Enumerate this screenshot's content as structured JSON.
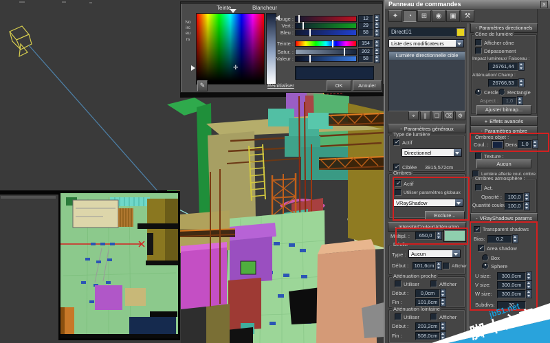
{
  "colors": {
    "annotation": "#d42020",
    "object_swatch": "#e8d31f",
    "multiplier_swatch": "#8fcfae",
    "shadow_color_swatch": "#15233f",
    "picker_preview": "#17263f",
    "watermark_blue": "#29a3dc"
  },
  "picker": {
    "hue_label": "Teinte",
    "whiteness_label": "Blancheur",
    "blackness_label": "Noirceurs",
    "eyedropper_glyph": "✎",
    "sliders": [
      {
        "label": "Rouge :",
        "value": "12"
      },
      {
        "label": "Vert :",
        "value": "29"
      },
      {
        "label": "Bleu :",
        "value": "58"
      },
      {
        "label": "Teinte :",
        "value": "154"
      },
      {
        "label": "Satur. :",
        "value": "202"
      },
      {
        "label": "Valeur :",
        "value": "58"
      }
    ],
    "reset_label": "Réinitialiser",
    "ok_label": "OK",
    "cancel_label": "Annuler"
  },
  "panel": {
    "title": "Panneau de commandes",
    "close_glyph": "×",
    "tabs": [
      {
        "name": "create",
        "glyph": "✦"
      },
      {
        "name": "modify",
        "glyph": "◔"
      },
      {
        "name": "hierarchy",
        "glyph": "⊞"
      },
      {
        "name": "motion",
        "glyph": "◉"
      },
      {
        "name": "display",
        "glyph": "▣"
      },
      {
        "name": "utilities",
        "glyph": "⚒"
      }
    ],
    "object_name": "Direct01",
    "modifier_list_label": "Liste des modificateurs",
    "stack_selected": "Lumière directionnelle cible",
    "stack_buttons": [
      {
        "name": "pin-stack",
        "glyph": "⌖"
      },
      {
        "name": "show-end-result",
        "glyph": "∥"
      },
      {
        "name": "make-unique",
        "glyph": "❏"
      },
      {
        "name": "remove-modifier",
        "glyph": "⌫"
      },
      {
        "name": "configure-modifier-sets",
        "glyph": "⚙"
      }
    ],
    "general": {
      "prefix": "-",
      "title": "Paramètres généraux",
      "light_type_group": "Type de lumière",
      "active": {
        "label": "Actif",
        "state": "✓"
      },
      "type_value": "Directionnel",
      "targeted": {
        "label": "Ciblée",
        "state": "✓"
      },
      "target_distance": "3915,572cm",
      "shadows_group": "Ombres",
      "shadows_active": {
        "label": "Actif",
        "state": "✓"
      },
      "use_global": {
        "label": "Utiliser paramètres globaux",
        "state": ""
      },
      "shadow_type": "VRayShadow",
      "exclude_label": "Exclure..."
    },
    "intensity": {
      "prefix": "-",
      "title": "Intensité/Couleur/Atténuation",
      "mult_label": "Multipl. :",
      "mult_value": "650,0",
      "decay_group": "Déclin",
      "type_label": "Type :",
      "type_value": "Aucun",
      "start_label": "Début :",
      "start_value": "101,6cm",
      "show": {
        "label": "Afficher",
        "state": ""
      },
      "near_group": "Atténuation proche",
      "near_use": {
        "label": "Utiliser",
        "state": ""
      },
      "near_show": {
        "label": "Afficher",
        "state": ""
      },
      "near_start_label": "Début :",
      "near_start": "0,0cm",
      "near_end_label": "Fin :",
      "near_end": "101,6cm",
      "far_group": "Atténuation lointaine",
      "far_use": {
        "label": "Utiliser",
        "state": ""
      },
      "far_show": {
        "label": "Afficher",
        "state": ""
      },
      "far_start_label": "Début :",
      "far_start": "203,2cm",
      "far_end_label": "Fin :",
      "far_end": "508,0cm"
    },
    "directional": {
      "prefix": "-",
      "title": "Paramètres directionnels",
      "cone_group": "Cône de lumière",
      "show_cone": {
        "label": "Afficher cône",
        "state": ""
      },
      "overshoot": {
        "label": "Dépassement",
        "state": ""
      },
      "hotspot_label": "Impact lumineux/ Faisceau :",
      "hotspot_value": "26761,44",
      "falloff_label": "Atténuation/ Champ :",
      "falloff_value": "26766,53",
      "circle": {
        "label": "Cercle",
        "state": "●"
      },
      "rectangle": {
        "label": "Rectangle",
        "state": ""
      },
      "aspect_label": "Aspect :",
      "aspect_value": "1,0",
      "bitmap_fit_label": "Ajuster bitmap..."
    },
    "advanced": {
      "prefix": "+",
      "title": "Effets avancés"
    },
    "shadow_params": {
      "prefix": "-",
      "title": "Paramètres ombre",
      "object_group": "Ombres objet :",
      "color_label": "Coul. :",
      "density_label": "Dens.",
      "density_value": "1,0",
      "map": {
        "label": "Texture :",
        "state": ""
      },
      "map_button": "Aucun",
      "light_affects": {
        "label": "Lumière affecte coul. ombre",
        "state": ""
      },
      "atmosphere_group": "Ombres atmosphère :",
      "active": {
        "label": "Act.",
        "state": ""
      },
      "opacity_label": "Opacité :",
      "opacity_value": "100,0",
      "color_amount_label": "Quantité couleur :",
      "color_amount_value": "100,0"
    },
    "vray": {
      "prefix": "-",
      "title": "VRayShadows params",
      "transparent": {
        "label": "Transparent shadows",
        "state": "✓"
      },
      "bias_label": "Bias:",
      "bias_value": "0,2",
      "area": {
        "label": "Area shadow",
        "state": "✓"
      },
      "box": {
        "label": "Box",
        "state": ""
      },
      "sphere": {
        "label": "Sphere",
        "state": "●"
      },
      "usize_label": "U size:",
      "usize_value": "300,0cm",
      "vsize_label": "V size:",
      "vsize_value": "300,0cm",
      "wsize_label": "W size:",
      "wsize_value": "300,0cm",
      "subdivs_label": "Subdivs:",
      "subdivs_value": "30"
    }
  },
  "watermark": {
    "site": "jb51.net",
    "name": "脚本之家"
  }
}
